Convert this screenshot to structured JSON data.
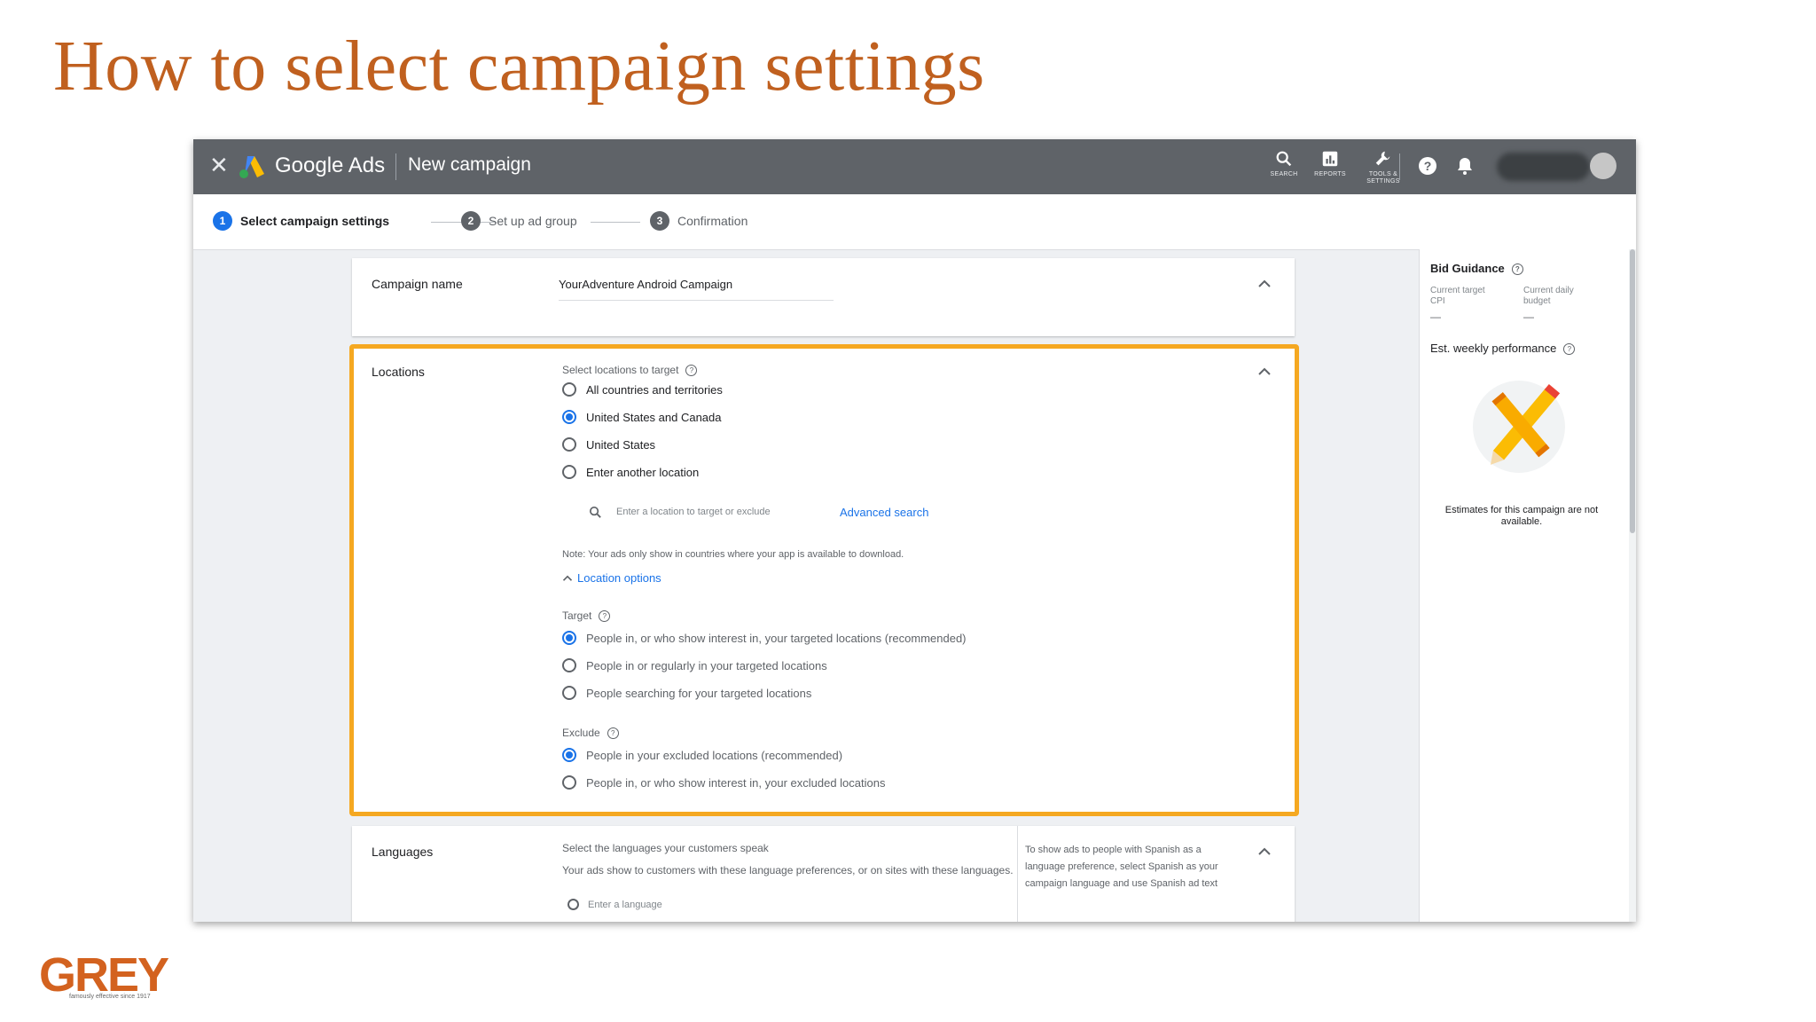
{
  "slide": {
    "title": "How to select campaign settings",
    "logo_text": "GREY",
    "logo_tagline": "famously effective since 1917"
  },
  "topbar": {
    "close_icon": "close-icon",
    "brand": "Google Ads",
    "page_title": "New campaign",
    "tools": [
      {
        "icon": "search-icon",
        "label": "SEARCH"
      },
      {
        "icon": "reports-icon",
        "label": "REPORTS"
      },
      {
        "icon": "wrench-icon",
        "label": "TOOLS & SETTINGS"
      }
    ],
    "help_icon": "help-icon",
    "notifications_icon": "bell-icon",
    "colors": {
      "bar": "#5f6368"
    }
  },
  "stepper": {
    "steps": [
      {
        "number": "1",
        "label": "Select campaign settings",
        "state": "active"
      },
      {
        "number": "2",
        "label": "Set up ad group",
        "state": "inactive"
      },
      {
        "number": "3",
        "label": "Confirmation",
        "state": "inactive"
      }
    ]
  },
  "campaign_name": {
    "label": "Campaign name",
    "value": "YourAdventure Android Campaign"
  },
  "locations": {
    "label": "Locations",
    "prompt": "Select locations to target",
    "options": [
      {
        "label": "All countries and territories",
        "selected": false
      },
      {
        "label": "United States and Canada",
        "selected": true
      },
      {
        "label": "United States",
        "selected": false
      },
      {
        "label": "Enter another location",
        "selected": false
      }
    ],
    "search_placeholder": "Enter a location to target or exclude",
    "advanced_search": "Advanced search",
    "note": "Note: Your ads only show in countries where your app is available to download.",
    "location_options_link": "Location options",
    "target": {
      "heading": "Target",
      "options": [
        {
          "label": "People in, or who show interest in, your targeted locations (recommended)",
          "selected": true
        },
        {
          "label": "People in or regularly in your targeted locations",
          "selected": false
        },
        {
          "label": "People searching for your targeted locations",
          "selected": false
        }
      ]
    },
    "exclude": {
      "heading": "Exclude",
      "options": [
        {
          "label": "People in your excluded locations (recommended)",
          "selected": true
        },
        {
          "label": "People in, or who show interest in, your excluded locations",
          "selected": false
        }
      ]
    },
    "highlight_color": "#f5a821"
  },
  "languages": {
    "label": "Languages",
    "prompt": "Select the languages your customers speak",
    "description": "Your ads show to customers with these language preferences, or on sites with these languages.",
    "input_placeholder": "Enter a language",
    "hint": "To show ads to people with Spanish as a language preference, select Spanish as your campaign language and use Spanish ad text"
  },
  "side_panel": {
    "bid_guidance_title": "Bid Guidance",
    "current_target_label": "Current target CPI",
    "current_target_value": "—",
    "current_budget_label": "Current daily budget",
    "current_budget_value": "—",
    "weekly_title": "Est. weekly performance",
    "illustration_icon": "pencil-cross-icon",
    "empty_message": "Estimates for this campaign are not available."
  }
}
